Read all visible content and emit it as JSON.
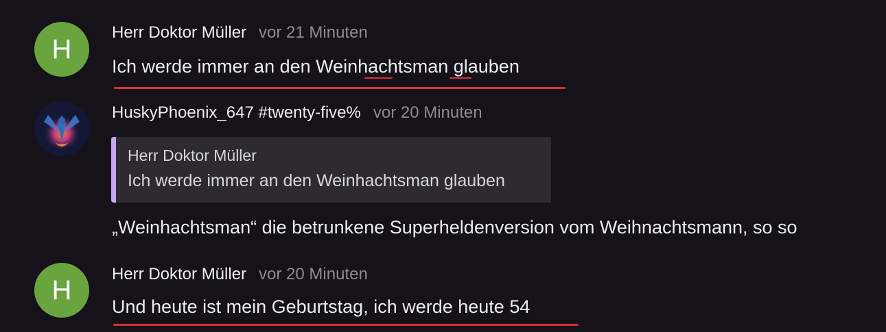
{
  "messages": [
    {
      "avatar_letter": "H",
      "avatar_color": "#6aa43f",
      "author": "Herr Doktor Müller",
      "time": "vor 21 Minuten",
      "text": "Ich werde immer an den Weinhachtsman glauben"
    },
    {
      "avatar_icon": "phoenix-avatar-icon",
      "author": "HuskyPhoenix_647 #twenty-five%",
      "time": "vor 20 Minuten",
      "quote": {
        "author": "Herr Doktor Müller",
        "text": "Ich werde immer an den Weinhachtsman glauben"
      },
      "text": "„Weinhachtsman“ die betrunkene Superheldenversion vom Weihnachtsmann, so so"
    },
    {
      "avatar_letter": "H",
      "avatar_color": "#6aa43f",
      "author": "Herr Doktor Müller",
      "time": "vor 20 Minuten",
      "text": "Und heute ist mein Geburtstag, ich werde heute 54"
    }
  ],
  "colors": {
    "background": "#15121a",
    "spellcheck_underline": "#d8303c",
    "quote_bar": "#c8a6ee",
    "quote_background": "#2d2b31"
  }
}
